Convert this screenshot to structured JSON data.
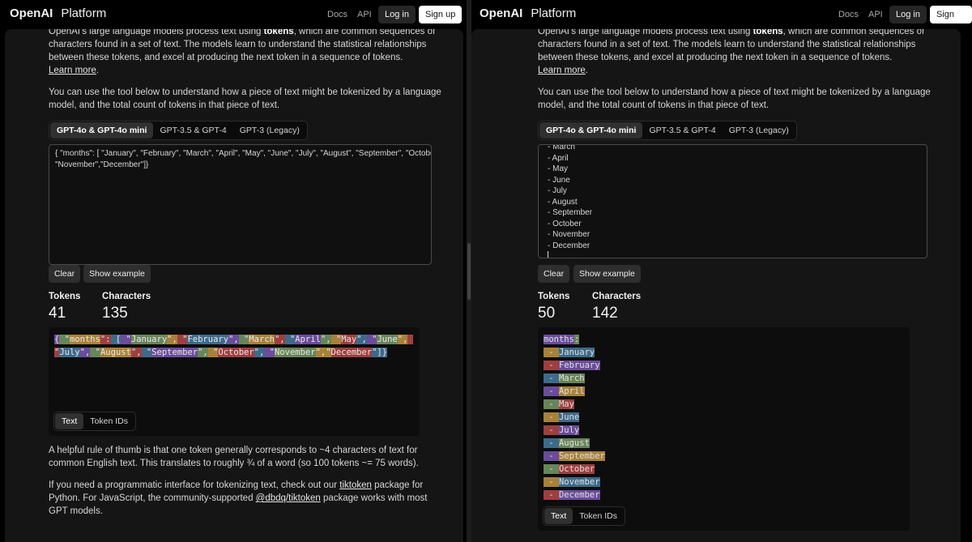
{
  "nav": {
    "brand": "OpenAI",
    "brand_sub": "Platform",
    "docs": "Docs",
    "api": "API",
    "login": "Log in",
    "signup": "Sign up"
  },
  "intro": {
    "line1_pre": "OpenAI's large language models process text using ",
    "line1_bold": "tokens",
    "line1_post": ", which are common sequences of",
    "line2": "characters found in a set of text. The models learn to understand the statistical relationships",
    "line3": "between these tokens, and excel at producing the next token in a sequence of tokens.",
    "learn_more": "Learn more"
  },
  "tool_intro": {
    "line1": "You can use the tool below to understand how a piece of text might be tokenized by a language",
    "line2": "model, and the total count of tokens in that piece of text."
  },
  "model_tabs": [
    "GPT-4o & GPT-4o mini",
    "GPT-3.5 & GPT-4",
    "GPT-3 (Legacy)"
  ],
  "buttons": {
    "clear": "Clear",
    "show_example": "Show example"
  },
  "labels": {
    "tokens": "Tokens",
    "characters": "Characters"
  },
  "view_tabs": [
    "Text",
    "Token IDs"
  ],
  "footer": {
    "p1_line1": "A helpful rule of thumb is that one token generally corresponds to ~4 characters of text for",
    "p1_line2": "common English text. This translates to roughly ¾ of a word (so 100 tokens ~= 75 words).",
    "p2_pre": "If you need a programmatic interface for tokenizing text, check out our ",
    "p2_link1": "tiktoken",
    "p2_mid": " package for",
    "p2_line2_pre": "Python. For JavaScript, the community-supported ",
    "p2_link2": "@dbdq/tiktoken",
    "p2_line2_post": " package works with most",
    "p2_line3": "GPT models."
  },
  "left": {
    "input_lines": [
      "{ \"months\": [ \"January\", \"February\", \"March\", \"April\", \"May\", \"June\", \"July\", \"August\", \"September\", \"October\",",
      "\"November\",\"December\"]}"
    ],
    "tokens": "41",
    "characters": "135",
    "token_pieces": [
      "{",
      " \"",
      "months",
      "\":",
      " [",
      " \"",
      "January",
      "\",",
      " \"",
      "February",
      "\",",
      " \"",
      "March",
      "\",",
      " \"",
      "April",
      "\",",
      " \"",
      "May",
      "\",",
      " \"",
      "June",
      "\",",
      " \"",
      "July",
      "\",",
      " \"",
      "August",
      "\",",
      " \"",
      "September",
      "\",",
      " \"",
      "October",
      "\",",
      " \"",
      "November",
      "\",\"",
      "December",
      "\"]}"
    ]
  },
  "right": {
    "input_lines": [
      "- March",
      "- April",
      "- May",
      "- June",
      "- July",
      "- August",
      "- September",
      "- October",
      "- November",
      "- December",
      ""
    ],
    "tokens": "50",
    "characters": "142",
    "yaml_key": "months",
    "yaml_colon": ":",
    "yaml_items": [
      "January",
      "February",
      "March",
      "April",
      "May",
      "June",
      "July",
      "August",
      "September",
      "October",
      "November",
      "December"
    ],
    "yaml_dash": " - "
  },
  "token_colors": [
    "#6b4c9a",
    "#68855a",
    "#a8813a",
    "#9e3f3f",
    "#3e6a8a"
  ]
}
